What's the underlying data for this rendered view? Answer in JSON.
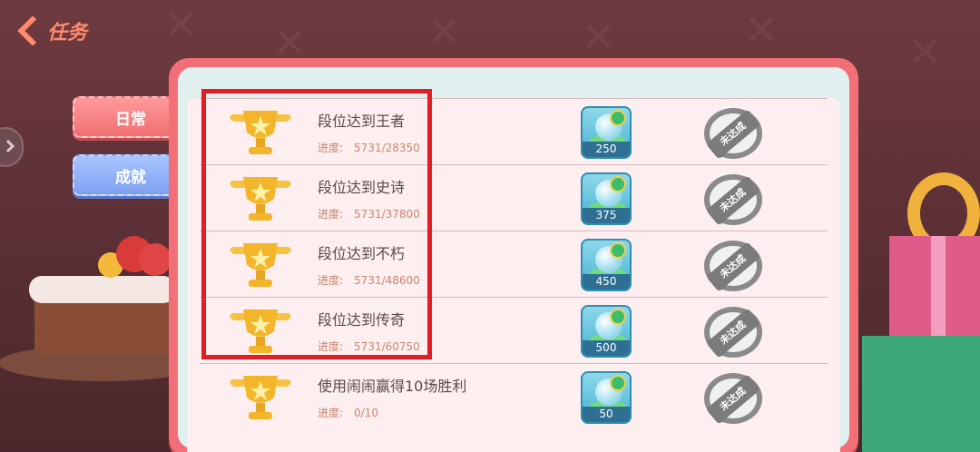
{
  "header": {
    "title": "任务"
  },
  "tabs": [
    {
      "label": "日常"
    },
    {
      "label": "成就"
    }
  ],
  "tasks": [
    {
      "title": "段位达到王者",
      "progress_label": "进度:",
      "progress_value": "5731/28350",
      "reward_count": "250",
      "status": "未达成"
    },
    {
      "title": "段位达到史诗",
      "progress_label": "进度:",
      "progress_value": "5731/37800",
      "reward_count": "375",
      "status": "未达成"
    },
    {
      "title": "段位达到不朽",
      "progress_label": "进度:",
      "progress_value": "5731/48600",
      "reward_count": "450",
      "status": "未达成"
    },
    {
      "title": "段位达到传奇",
      "progress_label": "进度:",
      "progress_value": "5731/60750",
      "reward_count": "500",
      "status": "未达成"
    },
    {
      "title": "使用闹闹赢得10场胜利",
      "progress_label": "进度:",
      "progress_value": "0/10",
      "reward_count": "50",
      "status": "未达成"
    }
  ],
  "icons": {
    "back": "back-arrow-icon",
    "trophy": "trophy-icon",
    "reward": "reward-item-icon",
    "side": "chevron-right-icon"
  },
  "colors": {
    "accent": "#ff8a6e",
    "panel": "#f36f78",
    "tab_daily": "#f06f72",
    "tab_achievement": "#7d9ff0",
    "highlight": "#e21d23"
  }
}
